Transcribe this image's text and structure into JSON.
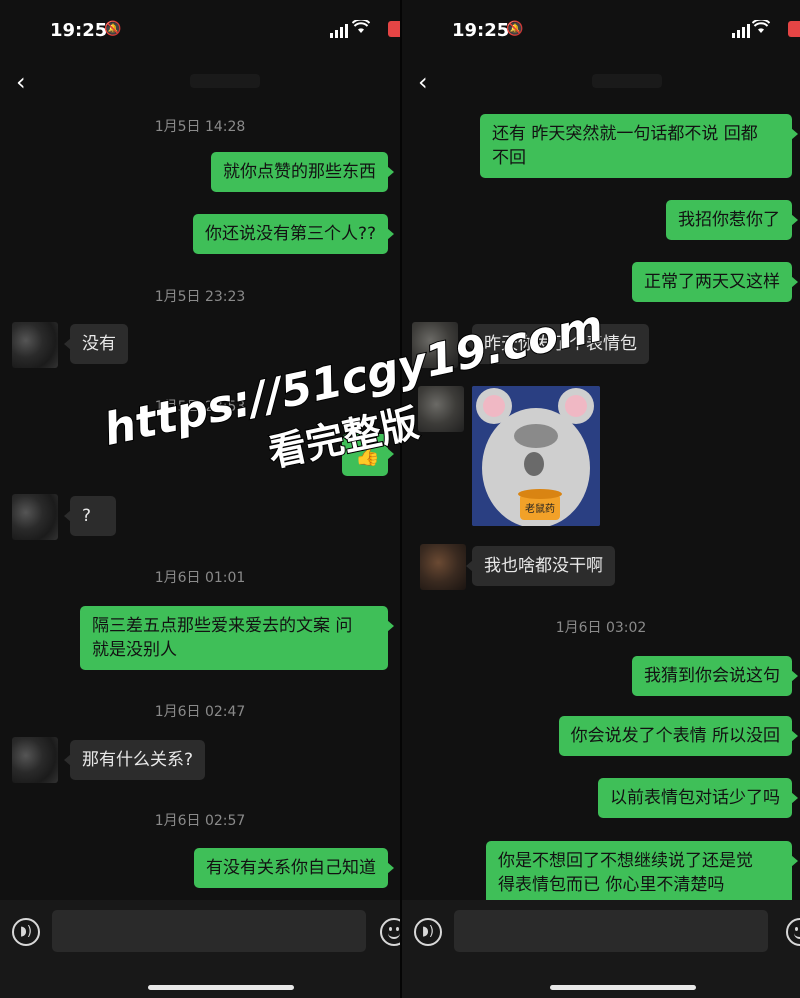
{
  "status": {
    "time": "19:25",
    "battery": "1"
  },
  "input": {
    "placeholder": ""
  },
  "watermark": {
    "line1": "https://51cgy19.com",
    "line2": "看完整版"
  },
  "left": {
    "timestamps": [
      "1月5日 14:28",
      "1月5日 23:23",
      "1月5日 23:53",
      "1月6日 01:01",
      "1月6日 02:47",
      "1月6日 02:57"
    ],
    "messages": [
      {
        "text": "就你点赞的那些东西"
      },
      {
        "text": "你还说没有第三个人??"
      },
      {
        "text": "没有"
      },
      {
        "text": "👍"
      },
      {
        "text": "?"
      },
      {
        "text1": "隔三差五点那些爱来爱去的文案 问",
        "text2": "就是没别人"
      },
      {
        "text": "那有什么关系?"
      },
      {
        "text": "有没有关系你自己知道"
      }
    ]
  },
  "right": {
    "timestamps": [
      "1月6日 03:02"
    ],
    "messages": [
      {
        "text1": "还有 昨天突然就一句话都不说 回都",
        "text2": "不回"
      },
      {
        "text": "我招你惹你了"
      },
      {
        "text": "正常了两天又这样"
      },
      {
        "text": "昨天你发了个表情包"
      },
      {
        "sticker_label": "老鼠药"
      },
      {
        "text": "我也啥都没干啊"
      },
      {
        "text": "我猜到你会说这句"
      },
      {
        "text": "你会说发了个表情 所以没回"
      },
      {
        "text": "以前表情包对话少了吗"
      },
      {
        "text1": "你是不想回了不想继续说了还是觉",
        "text2": "得表情包而已 你心里不清楚吗"
      }
    ]
  }
}
